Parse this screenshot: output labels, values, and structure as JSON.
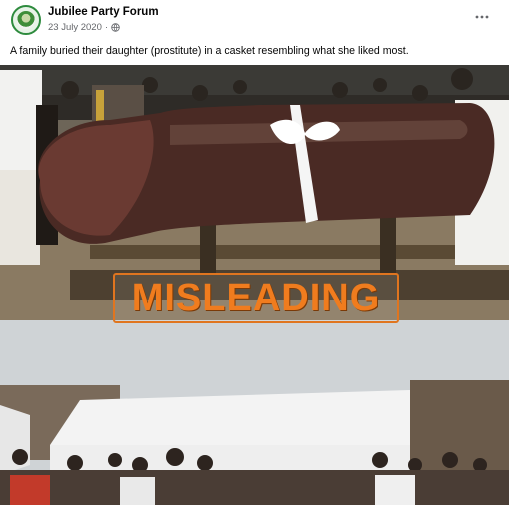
{
  "post": {
    "author": "Jubilee Party Forum",
    "date": "23 July 2020",
    "date_separator": "·",
    "caption": "A family buried their daughter (prostitute) in a casket resembling what she liked most.",
    "verdict_label": "MISLEADING"
  },
  "icons": {
    "avatar": "party-logo-avatar",
    "privacy": "globe-icon",
    "menu": "more-options-icon"
  },
  "colors": {
    "verdict": "#f07c1e",
    "author_text": "#050505",
    "meta_text": "#65676b"
  }
}
